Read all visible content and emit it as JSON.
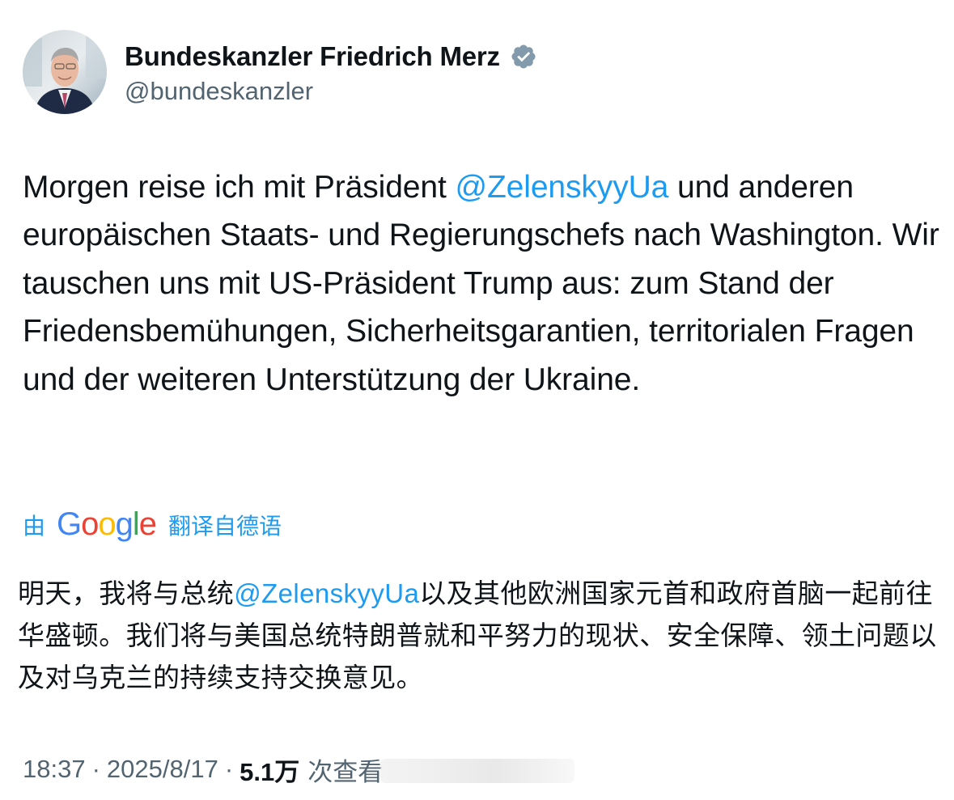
{
  "author": {
    "display_name": "Bundeskanzler Friedrich Merz",
    "handle": "@bundeskanzler",
    "verified": true,
    "verified_icon": "verified-badge-icon",
    "verified_color": "#829aab"
  },
  "tweet": {
    "segments": [
      {
        "type": "text",
        "value": "Morgen reise ich mit Präsident "
      },
      {
        "type": "mention",
        "value": "@ZelenskyyUa"
      },
      {
        "type": "text",
        "value": " und anderen europäischen Staats- und Regierungschefs nach Washington. Wir tauschen uns mit US-Präsident Trump aus: zum Stand der Friedensbemühungen, Sicherheitsgarantien, territorialen Fragen und der weiteren Unterstützung der Ukraine."
      }
    ]
  },
  "translation": {
    "prefix": "由",
    "logo_text": "Google",
    "suffix": "翻译自德语",
    "segments": [
      {
        "type": "text",
        "value": "明天，我将与总统"
      },
      {
        "type": "mention",
        "value": "@ZelenskyyUa"
      },
      {
        "type": "text",
        "value": "以及其他欧洲国家元首和政府首脑一起前往华盛顿。我们将与美国总统特朗普就和平努力的现状、安全保障、领土问题以及对乌克兰的持续支持交换意见。"
      }
    ]
  },
  "meta": {
    "time": "18:37",
    "separator": "·",
    "date": "2025/8/17",
    "views_count": "5.1万",
    "views_label": "次查看"
  },
  "colors": {
    "text": "#0f1419",
    "secondary": "#536471",
    "link": "#1d9bf0"
  }
}
